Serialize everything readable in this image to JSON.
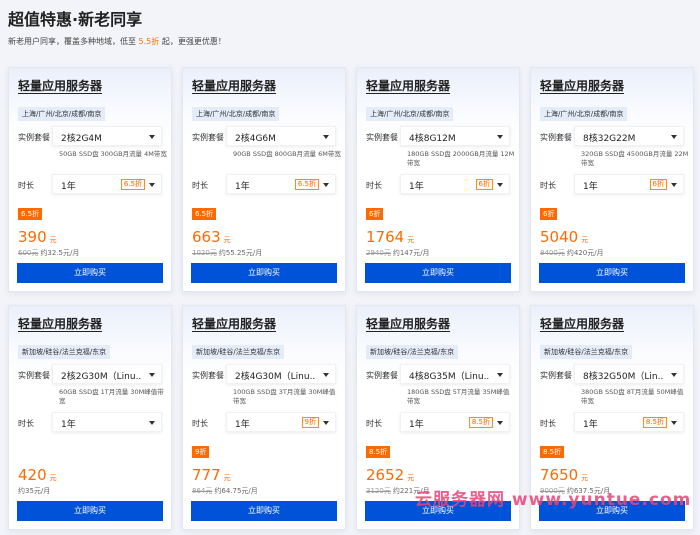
{
  "page": {
    "title": "超值特惠·新老同享",
    "subtitle_prefix": "新老用户同享，覆盖多种地域，低至 ",
    "subtitle_highlight": "5.5折",
    "subtitle_suffix": " 起，更强更优惠！"
  },
  "labels": {
    "spec": "实例套餐",
    "duration": "时长",
    "buy": "立即购买",
    "unit": "元"
  },
  "watermark": "云服务器网 www.yuntue.com",
  "colors": {
    "accent": "#ff6a00",
    "button": "#0052d9",
    "region_bg": "#e4ecfa",
    "watermark": "#e8447a"
  },
  "cards": [
    {
      "title": "轻量应用服务器",
      "region": "上海/广州/北京/成都/南京",
      "spec": "2核2G4M",
      "desc": "50GB SSD盘 300GB月流量 4M带宽",
      "duration": "1年",
      "discount": "6.5折",
      "badge": "6.5折",
      "price": "390",
      "orig": "600元",
      "monthly": "约32.5元/月"
    },
    {
      "title": "轻量应用服务器",
      "region": "上海/广州/北京/成都/南京",
      "spec": "2核4G6M",
      "desc": "90GB SSD盘 800GB月流量 6M带宽",
      "duration": "1年",
      "discount": "6.5折",
      "badge": "6.5折",
      "price": "663",
      "orig": "1020元",
      "monthly": "约55.25元/月"
    },
    {
      "title": "轻量应用服务器",
      "region": "上海/广州/北京/成都/南京",
      "spec": "4核8G12M",
      "desc": "180GB SSD盘 2000GB月流量 12M带宽",
      "duration": "1年",
      "discount": "6折",
      "badge": "6折",
      "price": "1764",
      "orig": "2940元",
      "monthly": "约147元/月"
    },
    {
      "title": "轻量应用服务器",
      "region": "上海/广州/北京/成都/南京",
      "spec": "8核32G22M",
      "desc": "320GB SSD盘 4500GB月流量 22M带宽",
      "duration": "1年",
      "discount": "6折",
      "badge": "6折",
      "price": "5040",
      "orig": "8400元",
      "monthly": "约420元/月"
    },
    {
      "title": "轻量应用服务器",
      "region": "新加坡/硅谷/法兰克福/东京",
      "spec": "2核2G30M（Linu...",
      "desc": "60GB SSD盘 1T月流量 30M峰值带宽",
      "duration": "1年",
      "discount": "",
      "badge": "",
      "price": "420",
      "orig": "",
      "monthly": "约35元/月"
    },
    {
      "title": "轻量应用服务器",
      "region": "新加坡/硅谷/法兰克福/东京",
      "spec": "2核4G30M（Linu...",
      "desc": "100GB SSD盘 3T月流量 30M峰值带宽",
      "duration": "1年",
      "discount": "9折",
      "badge": "9折",
      "price": "777",
      "orig": "864元",
      "monthly": "约64.75元/月"
    },
    {
      "title": "轻量应用服务器",
      "region": "新加坡/硅谷/法兰克福/东京",
      "spec": "4核8G35M（Linu...",
      "desc": "180GB SSD盘 5T月流量 35M峰值带宽",
      "duration": "1年",
      "discount": "8.5折",
      "badge": "8.5折",
      "price": "2652",
      "orig": "3120元",
      "monthly": "约221元/月"
    },
    {
      "title": "轻量应用服务器",
      "region": "新加坡/硅谷/法兰克福/东京",
      "spec": "8核32G50M（Lin...",
      "desc": "380GB SSD盘 8T月流量 50M峰值带宽",
      "duration": "1年",
      "discount": "8.5折",
      "badge": "8.5折",
      "price": "7650",
      "orig": "9000元",
      "monthly": "约637.5元/月"
    }
  ]
}
